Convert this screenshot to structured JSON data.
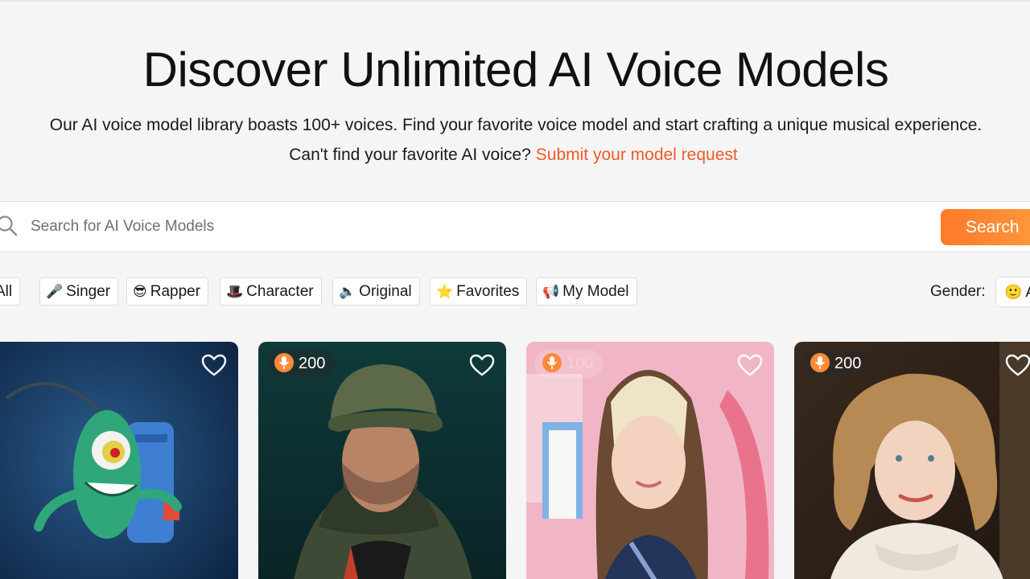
{
  "hero": {
    "title": "Discover Unlimited AI Voice Models",
    "subtitle": "Our AI voice model library boasts 100+ voices. Find your favorite voice model and start crafting a unique musical experience.",
    "request_prompt": "Can't find your favorite AI voice?",
    "request_link": "Submit your model request"
  },
  "search": {
    "placeholder": "Search for AI Voice Models",
    "button_label": "Search",
    "icon": "search-icon"
  },
  "filters": [
    {
      "label": "All",
      "emoji": ""
    },
    {
      "label": "Singer",
      "emoji": "🎤"
    },
    {
      "label": "Rapper",
      "emoji": "😎"
    },
    {
      "label": "Character",
      "emoji": "🎩"
    },
    {
      "label": "Original",
      "emoji": "🔈"
    },
    {
      "label": "Favorites",
      "emoji": "⭐"
    },
    {
      "label": "My Model",
      "emoji": "📢"
    }
  ],
  "gender": {
    "label": "Gender:",
    "selected": "A",
    "emoji": "🙂"
  },
  "cards": [
    {
      "uses": "",
      "icon": "heart-icon",
      "scene": "green cartoon character with antenna"
    },
    {
      "uses": "200",
      "icon": "heart-icon",
      "scene": "man in green cap and hooded jacket"
    },
    {
      "uses": "100",
      "icon": "heart-icon",
      "scene": "woman with blonde-highlighted hair on pink background"
    },
    {
      "uses": "200",
      "icon": "heart-icon",
      "scene": "woman with curly hair in white sweater"
    }
  ],
  "colors": {
    "accent": "#f05a28",
    "button_gradient_start": "#ff7a2a",
    "button_gradient_end": "#ff9a3c",
    "page_background": "#f5f5f6"
  }
}
